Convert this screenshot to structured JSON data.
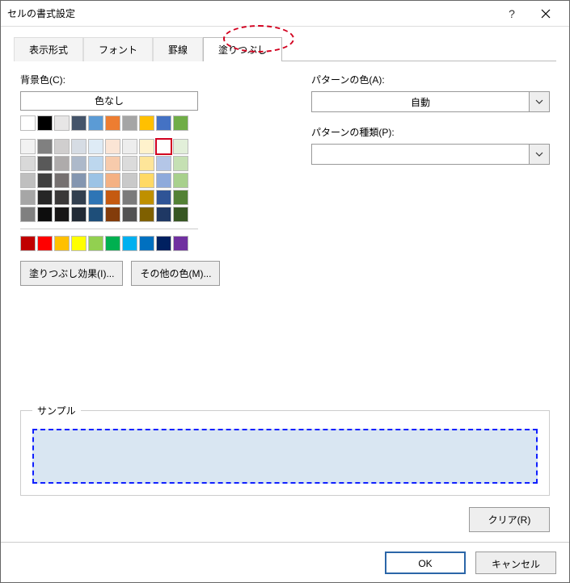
{
  "window": {
    "title": "セルの書式設定"
  },
  "tabs": {
    "display": "表示形式",
    "font": "フォント",
    "border": "罫線",
    "fill": "塗りつぶし"
  },
  "fill": {
    "bgcolor_label": "背景色(C):",
    "no_color": "色なし",
    "effects_btn": "塗りつぶし効果(I)...",
    "more_colors_btn": "その他の色(M)...",
    "pattern_color_label": "パターンの色(A):",
    "pattern_color_value": "自動",
    "pattern_type_label": "パターンの種類(P):",
    "pattern_type_value": ""
  },
  "sample": {
    "legend": "サンプル"
  },
  "buttons": {
    "clear": "クリア(R)",
    "ok": "OK",
    "cancel": "キャンセル"
  },
  "palette": {
    "row1": [
      "#ffffff",
      "#000000",
      "#e7e6e6",
      "#44546a",
      "#5b9bd5",
      "#ed7d31",
      "#a5a5a5",
      "#ffc000",
      "#4472c4",
      "#70ad47"
    ],
    "grid": [
      [
        "#f2f2f2",
        "#808080",
        "#d0cece",
        "#d6dce4",
        "#deebf6",
        "#fbe5d5",
        "#ededed",
        "#fff2cc",
        "#d9e2f3",
        "#e2efd9"
      ],
      [
        "#d9d9d9",
        "#595959",
        "#aeabab",
        "#adb9ca",
        "#bdd7ee",
        "#f7cbac",
        "#dbdbdb",
        "#fee599",
        "#b4c6e7",
        "#c5e0b3"
      ],
      [
        "#bfbfbf",
        "#404040",
        "#757070",
        "#8496b0",
        "#9cc3e5",
        "#f4b183",
        "#c9c9c9",
        "#ffd965",
        "#8eaadb",
        "#a8d08d"
      ],
      [
        "#a6a6a6",
        "#262626",
        "#3a3838",
        "#323f4f",
        "#2e75b5",
        "#c55a11",
        "#7b7b7b",
        "#bf9000",
        "#2f5496",
        "#538135"
      ],
      [
        "#808080",
        "#0d0d0d",
        "#171616",
        "#222a35",
        "#1e4e79",
        "#833c0b",
        "#525252",
        "#7f6000",
        "#1f3864",
        "#375623"
      ]
    ],
    "standard": [
      "#c00000",
      "#ff0000",
      "#ffc000",
      "#ffff00",
      "#92d050",
      "#00b050",
      "#00b0f0",
      "#0070c0",
      "#002060",
      "#7030a0"
    ],
    "selected": {
      "grid_row": 0,
      "grid_col": 8
    }
  }
}
